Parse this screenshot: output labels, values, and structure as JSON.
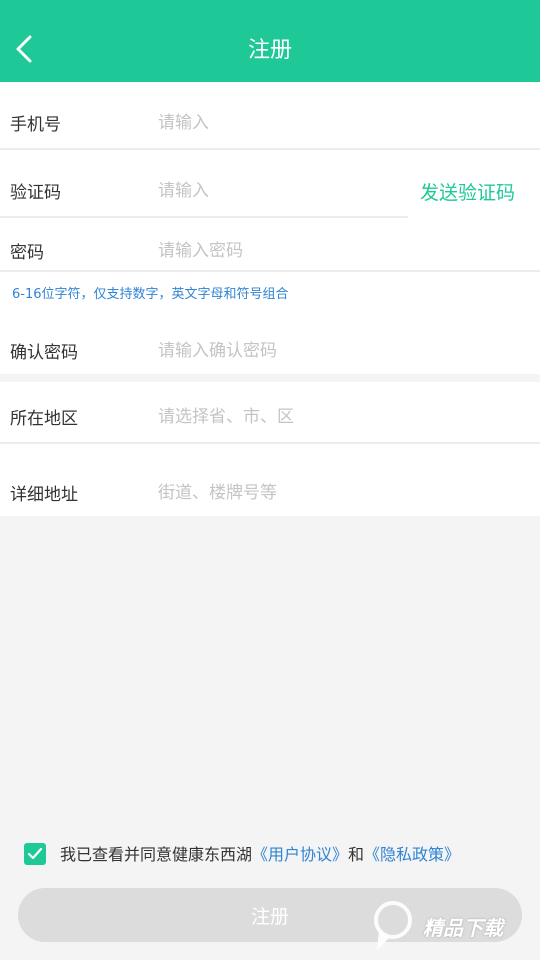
{
  "header": {
    "title": "注册"
  },
  "form": {
    "phone": {
      "label": "手机号",
      "placeholder": "请输入"
    },
    "code": {
      "label": "验证码",
      "placeholder": "请输入",
      "send_label": "发送验证码"
    },
    "password": {
      "label": "密码",
      "placeholder": "请输入密码",
      "hint": "6-16位字符，仅支持数字，英文字母和符号组合"
    },
    "confirm": {
      "label": "确认密码",
      "placeholder": "请输入确认密码"
    },
    "region": {
      "label": "所在地区",
      "placeholder": "请选择省、市、区"
    },
    "address": {
      "label": "详细地址",
      "placeholder": "街道、楼牌号等"
    }
  },
  "agreement": {
    "checked": true,
    "prefix": "我已查看并同意健康东西湖",
    "user_agreement": "《用户协议》",
    "and": "和",
    "privacy_policy": "《隐私政策》"
  },
  "register_button": {
    "label": "注册"
  },
  "colors": {
    "accent": "#1ec997",
    "link": "#2f84d4",
    "button_disabled": "#dcdcdc"
  },
  "watermark": {
    "text": "精品下载"
  }
}
